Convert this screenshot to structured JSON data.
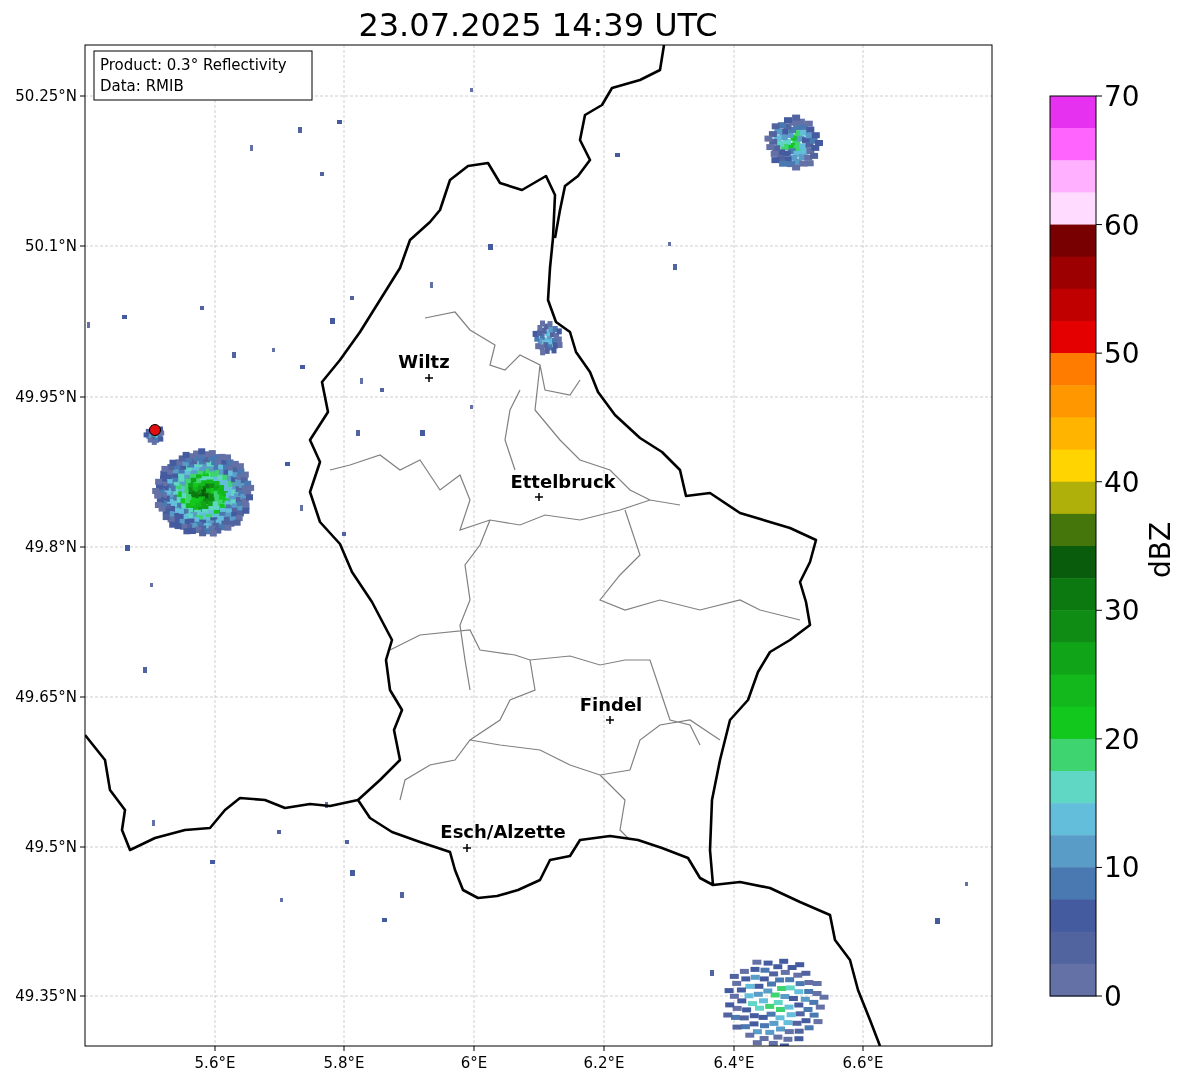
{
  "title": "23.07.2025 14:39 UTC",
  "info_box": [
    "Product: 0.3° Reflectivity",
    "Data: RMIB"
  ],
  "y_ticks": [
    "50.25°N",
    "50.1°N",
    "49.95°N",
    "49.8°N",
    "49.65°N",
    "49.5°N",
    "49.35°N"
  ],
  "x_ticks": [
    "5.6°E",
    "5.8°E",
    "6°E",
    "6.2°E",
    "6.4°E",
    "6.6°E"
  ],
  "cities": [
    "Wiltz",
    "Ettelbruck",
    "Findel",
    "Esch/Alzette"
  ],
  "colorbar": {
    "label": "dBZ",
    "ticks": [
      "70",
      "60",
      "50",
      "40",
      "30",
      "20",
      "10",
      "0"
    ],
    "bins": [
      {
        "color": "#e632f0"
      },
      {
        "color": "#ff64ff"
      },
      {
        "color": "#ffb0ff"
      },
      {
        "color": "#ffdcff"
      },
      {
        "color": "#780000"
      },
      {
        "color": "#9c0000"
      },
      {
        "color": "#c00000"
      },
      {
        "color": "#e40000"
      },
      {
        "color": "#ff7c00"
      },
      {
        "color": "#ff9800"
      },
      {
        "color": "#ffb400"
      },
      {
        "color": "#ffd400"
      },
      {
        "color": "#b0b00a"
      },
      {
        "color": "#44760c"
      },
      {
        "color": "#085c0c"
      },
      {
        "color": "#0c7810"
      },
      {
        "color": "#0e8c14"
      },
      {
        "color": "#10a418"
      },
      {
        "color": "#12b81c"
      },
      {
        "color": "#12c81c"
      },
      {
        "color": "#3ed470"
      },
      {
        "color": "#60d6c4"
      },
      {
        "color": "#63bedc"
      },
      {
        "color": "#5a9cc8"
      },
      {
        "color": "#4a78b0"
      },
      {
        "color": "#445ba0"
      },
      {
        "color": "#52649f"
      },
      {
        "color": "#6471a6"
      }
    ]
  }
}
